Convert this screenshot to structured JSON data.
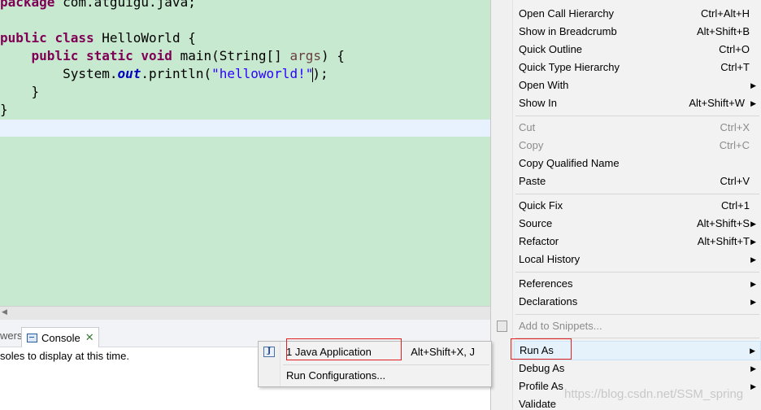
{
  "editor": {
    "lines": {
      "l1": {
        "kw": "package",
        "rest": " com.atguigu.java;"
      },
      "l3": {
        "kw1": "public",
        "kw2": "class",
        "rest": " HelloWorld {"
      },
      "l4": {
        "indent": "    ",
        "kw1": "public",
        "kw2": "static",
        "kw3": "void",
        "pre": " main(String[] ",
        "arg": "args",
        "post": ") {"
      },
      "l5": {
        "indent": "        ",
        "pre": "System.",
        "field": "out",
        "mid": ".println(",
        "str": "\"helloworld!\"",
        "post": ");"
      },
      "l6": {
        "text": "    }"
      },
      "l7": {
        "text": "}"
      }
    }
  },
  "bottom": {
    "prev_tab": "wers",
    "console_tab": "Console",
    "console_message": "soles to display at this time."
  },
  "context_menu": {
    "items": [
      {
        "label": "Open Call Hierarchy",
        "shortcut": "Ctrl+Alt+H"
      },
      {
        "label": "Show in Breadcrumb",
        "shortcut": "Alt+Shift+B"
      },
      {
        "label": "Quick Outline",
        "shortcut": "Ctrl+O"
      },
      {
        "label": "Quick Type Hierarchy",
        "shortcut": "Ctrl+T"
      },
      {
        "label": "Open With",
        "shortcut": ""
      },
      {
        "label": "Show In",
        "shortcut": "Alt+Shift+W"
      },
      {
        "label": "Cut",
        "shortcut": "Ctrl+X"
      },
      {
        "label": "Copy",
        "shortcut": "Ctrl+C"
      },
      {
        "label": "Copy Qualified Name",
        "shortcut": ""
      },
      {
        "label": "Paste",
        "shortcut": "Ctrl+V"
      },
      {
        "label": "Quick Fix",
        "shortcut": "Ctrl+1"
      },
      {
        "label": "Source",
        "shortcut": "Alt+Shift+S"
      },
      {
        "label": "Refactor",
        "shortcut": "Alt+Shift+T"
      },
      {
        "label": "Local History",
        "shortcut": ""
      },
      {
        "label": "References",
        "shortcut": ""
      },
      {
        "label": "Declarations",
        "shortcut": ""
      },
      {
        "label": "Add to Snippets...",
        "shortcut": ""
      },
      {
        "label": "Run As",
        "shortcut": ""
      },
      {
        "label": "Debug As",
        "shortcut": ""
      },
      {
        "label": "Profile As",
        "shortcut": ""
      },
      {
        "label": "Validate",
        "shortcut": ""
      }
    ]
  },
  "submenu": {
    "items": [
      {
        "label": "1 Java Application",
        "shortcut": "Alt+Shift+X, J"
      },
      {
        "label": "Run Configurations...",
        "shortcut": ""
      }
    ]
  },
  "watermark": "https://blog.csdn.net/SSM_spring",
  "colors": {
    "editor_bg": "#c7e9cf",
    "keyword": "#7f0055",
    "string": "#2a00ff",
    "field": "#0000c0",
    "highlight_box": "#e02020"
  }
}
